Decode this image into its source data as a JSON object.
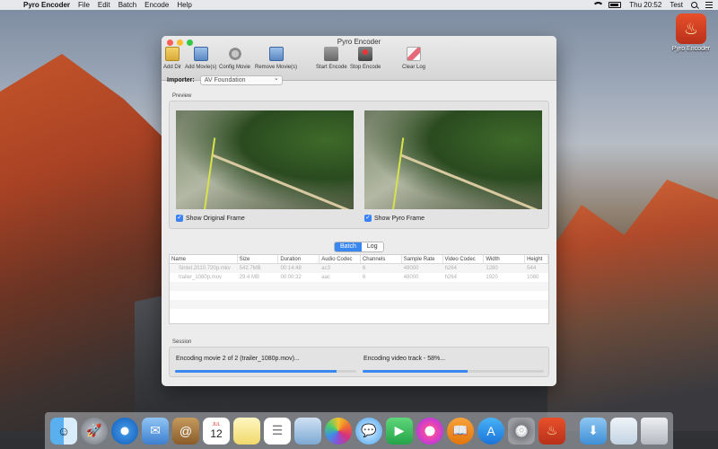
{
  "menubar": {
    "app_name": "Pyro Encoder",
    "items": [
      "File",
      "Edit",
      "Batch",
      "Encode",
      "Help"
    ],
    "clock": "Thu 20:52",
    "user": "Test"
  },
  "desktop": {
    "icon_label": "Pyro Encoder"
  },
  "window": {
    "title": "Pyro Encoder",
    "toolbar": {
      "add_dir": "Add Dir",
      "add_movies": "Add Movie(s)",
      "config_movie": "Config Movie",
      "remove_movies": "Remove Movie(s)",
      "start_encode": "Start Encode",
      "stop_encode": "Stop Encode",
      "clear_log": "Clear Log"
    },
    "importer": {
      "label": "Importer:",
      "value": "AV Foundation"
    },
    "preview": {
      "title": "Preview",
      "show_original": "Show Original Frame",
      "show_pyro": "Show Pyro Frame"
    },
    "tabs": {
      "batch": "Batch",
      "log": "Log"
    },
    "table": {
      "headers": [
        "Name",
        "Size",
        "Duration",
        "Audio Codec",
        "Channels",
        "Sample Rate",
        "Video Codec",
        "Width",
        "Height"
      ],
      "rows": [
        [
          "Sintel.2010.720p.mkv",
          "542.7MB",
          "00:14:48",
          "ac3",
          "6",
          "48000",
          "h264",
          "1280",
          "544"
        ],
        [
          "trailer_1080p.mov",
          "29.4 MB",
          "00:00:32",
          "aac",
          "6",
          "48000",
          "h264",
          "1920",
          "1080"
        ]
      ]
    },
    "session": {
      "title": "Session",
      "left_status": "Encoding movie 2 of 2 (trailer_1080p.mov)...",
      "right_status": "Encoding video track - 58%...",
      "left_progress": 0.89,
      "right_progress": 0.58
    }
  },
  "colors": {
    "accent": "#3b87f0"
  },
  "dock": {
    "calendar_month": "JUL",
    "calendar_day": "12",
    "items": [
      "finder-icon",
      "launchpad-icon",
      "safari-icon",
      "mail-icon",
      "contacts-icon",
      "calendar-icon",
      "notes-icon",
      "reminders-icon",
      "preview-icon",
      "photos-icon",
      "messages-icon",
      "facetime-icon",
      "itunes-icon",
      "ibooks-icon",
      "app-store-icon",
      "system-preferences-icon",
      "pyro-encoder-icon",
      "downloads-icon",
      "documents-icon",
      "trash-icon"
    ]
  }
}
